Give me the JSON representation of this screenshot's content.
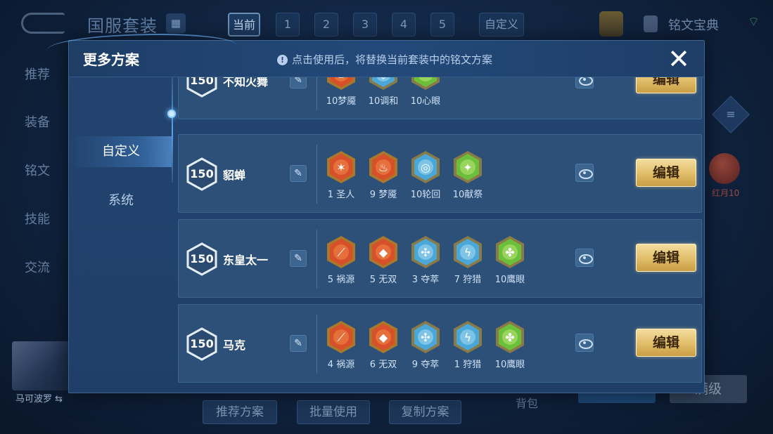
{
  "background": {
    "title": "国服套装",
    "tabs": [
      {
        "label": "当前",
        "selected": true
      },
      {
        "label": "1",
        "selected": false
      },
      {
        "label": "2",
        "selected": false
      },
      {
        "label": "3",
        "selected": false
      },
      {
        "label": "4",
        "selected": false
      },
      {
        "label": "5",
        "selected": false
      },
      {
        "label": "自定义",
        "selected": false
      }
    ],
    "dex_label": "铭文宝典",
    "side_nav": [
      "推荐",
      "装备",
      "铭文",
      "技能",
      "交流"
    ],
    "hero_name": "马可波罗",
    "bottom_buttons": [
      "推荐方案",
      "批量使用",
      "复制方案"
    ],
    "backpack_label": "背包",
    "full_level_label": "满级",
    "gem_label": "红月10"
  },
  "modal": {
    "title": "更多方案",
    "notice": "点击使用后，将替换当前套装中的铭文方案",
    "close_label": "✕",
    "tabs": [
      {
        "label": "自定义",
        "active": true
      },
      {
        "label": "系统",
        "active": false
      }
    ],
    "edit_label": "编辑",
    "presets": [
      {
        "level": "150",
        "name": "不知火舞",
        "runes": [
          {
            "label": "10梦魇",
            "color": "red",
            "icon": "flame-icon"
          },
          {
            "label": "10调和",
            "color": "blue",
            "icon": "drop-icon"
          },
          {
            "label": "10心眼",
            "color": "green",
            "icon": "leaf-icon"
          }
        ]
      },
      {
        "level": "150",
        "name": "貂蝉",
        "runes": [
          {
            "label": "1 圣人",
            "color": "red",
            "icon": "star-icon"
          },
          {
            "label": "9 梦魇",
            "color": "red",
            "icon": "flame-icon"
          },
          {
            "label": "10轮回",
            "color": "blue",
            "icon": "swirl-icon"
          },
          {
            "label": "10献祭",
            "color": "green",
            "icon": "leaf-icon"
          }
        ]
      },
      {
        "level": "150",
        "name": "东皇太一",
        "runes": [
          {
            "label": "5 祸源",
            "color": "red",
            "icon": "claw-icon"
          },
          {
            "label": "5 无双",
            "color": "red",
            "icon": "diamond-icon"
          },
          {
            "label": "3 夺萃",
            "color": "blue",
            "icon": "knot-icon"
          },
          {
            "label": "7 狩猎",
            "color": "blue",
            "icon": "bolt-icon"
          },
          {
            "label": "10鹰眼",
            "color": "green",
            "icon": "clover-icon"
          }
        ]
      },
      {
        "level": "150",
        "name": "马克",
        "runes": [
          {
            "label": "4 祸源",
            "color": "red",
            "icon": "claw-icon"
          },
          {
            "label": "6 无双",
            "color": "red",
            "icon": "diamond-icon"
          },
          {
            "label": "9 夺萃",
            "color": "blue",
            "icon": "knot-icon"
          },
          {
            "label": "1 狩猎",
            "color": "blue",
            "icon": "bolt-icon"
          },
          {
            "label": "10鹰眼",
            "color": "green",
            "icon": "clover-icon"
          }
        ]
      }
    ]
  },
  "colors": {
    "accent_gold": "#e0bd69",
    "rune_red": "#d8502a",
    "rune_blue": "#4aa7d8",
    "rune_green": "#6cbf3a",
    "panel": "#22446f"
  }
}
